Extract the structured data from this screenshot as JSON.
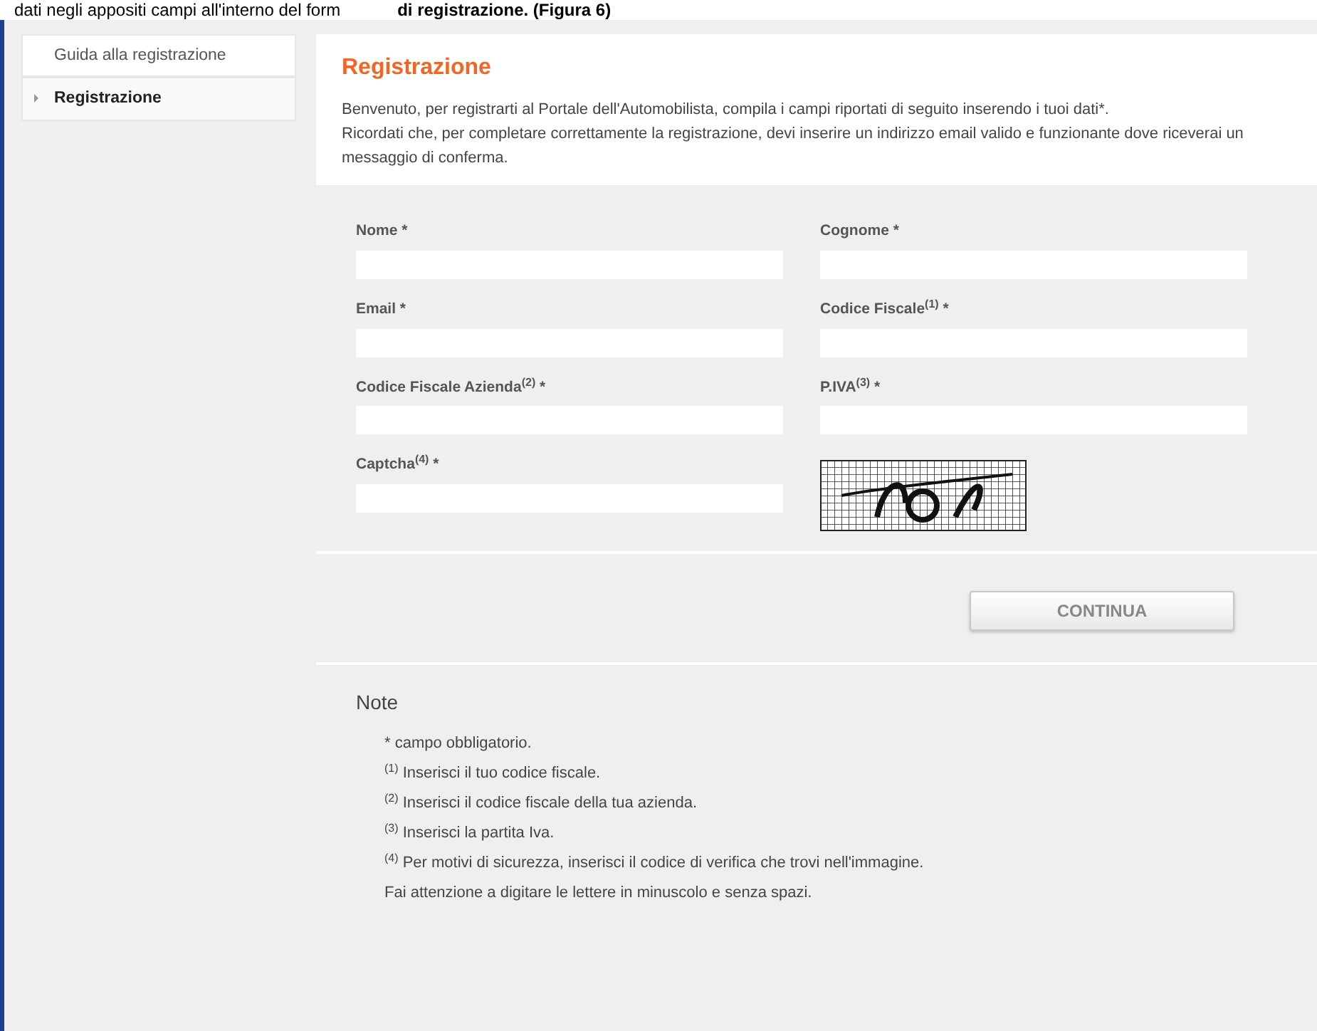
{
  "document_text": {
    "before": "dati negli appositi campi all'interno del form",
    "after": "di registrazione. (Figura 6)"
  },
  "sidebar": {
    "items": [
      {
        "label": "Guida alla registrazione",
        "selected": false
      },
      {
        "label": "Registrazione",
        "selected": true
      }
    ]
  },
  "header": {
    "title": "Registrazione",
    "paragraphs": [
      "Benvenuto, per registrarti al Portale dell'Automobilista, compila i campi riportati di seguito inserendo i tuoi dati*.",
      "Ricordati che, per completare correttamente la registrazione, devi inserire un indirizzo email valido e funzionante dove riceverai un messaggio di conferma."
    ]
  },
  "form": {
    "fields": [
      {
        "label": "Nome *",
        "kind": "input"
      },
      {
        "label": "Cognome *",
        "kind": "input"
      },
      {
        "label": "Email *",
        "kind": "input"
      },
      {
        "label": "Codice Fiscale$^{(1)}$ *",
        "kind": "input"
      },
      {
        "label": "Codice Fiscale Azienda$^{(2)}$ *",
        "kind": "input"
      },
      {
        "label": "P.IVA$^{(3)}$ *",
        "kind": "input"
      },
      {
        "label": "Captcha$^{(4)}$ *",
        "kind": "input"
      },
      {
        "kind": "captcha"
      }
    ]
  },
  "button": "CONTINUA",
  "notes": {
    "title": "Note",
    "lines": [
      "* campo obbligatorio.",
      "$^{(1)}$ Inserisci il tuo codice fiscale.",
      "$^{(2)}$ Inserisci il codice fiscale della tua azienda.",
      "$^{(3)}$ Inserisci la partita Iva.",
      "$^{(4)}$ Per motivi di sicurezza, inserisci il codice di verifica che trovi nell'immagine.",
      "Fai attenzione a digitare le lettere in minuscolo e senza spazi."
    ]
  }
}
